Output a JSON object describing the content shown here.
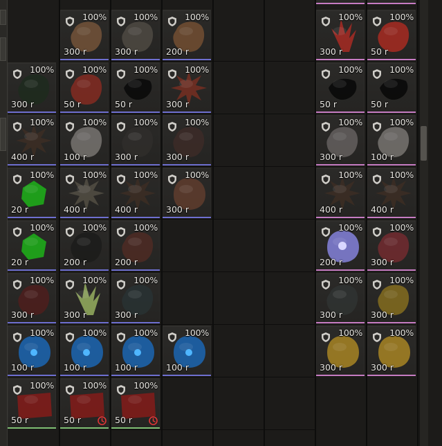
{
  "colors": {
    "underline_blue": "#6e6fd0",
    "underline_pink": "#c77cc3",
    "underline_green": "#7fbf74",
    "clock_red": "#e03636"
  },
  "left_items": [
    [
      null,
      {
        "pct": "100%",
        "price": "300 r",
        "icon": "coiled-tentacle-icon",
        "tint": "#6b4e37",
        "line": "blue"
      },
      {
        "pct": "100%",
        "price": "300 r",
        "icon": "bone-antler-icon",
        "tint": "#4a463f",
        "line": "blue"
      },
      {
        "pct": "100%",
        "price": "200 r",
        "icon": "organ-sac-icon",
        "tint": "#6a4a30",
        "line": "blue"
      }
    ],
    [
      {
        "pct": "100%",
        "price": "300 r",
        "icon": "dark-claw-icon",
        "tint": "#1f2a1f",
        "line": "blue"
      },
      {
        "pct": "100%",
        "price": "50 r",
        "icon": "red-crystal-icon",
        "tint": "#7a2a22",
        "line": "blue"
      },
      {
        "pct": "100%",
        "price": "50 r",
        "icon": "black-shard-icon",
        "tint": "#0c0c0c",
        "line": "blue"
      },
      {
        "pct": "100%",
        "price": "300 r",
        "icon": "red-spiked-pod-icon",
        "tint": "#6e2d22",
        "line": "blue"
      }
    ],
    [
      {
        "pct": "100%",
        "price": "400 r",
        "icon": "spiked-ball-icon",
        "tint": "#3a2c24",
        "line": "blue"
      },
      {
        "pct": "100%",
        "price": "100 r",
        "icon": "white-flower-icon",
        "tint": "#6f6c68",
        "line": "blue"
      },
      {
        "pct": "100%",
        "price": "300 r",
        "icon": "dark-rock-icon",
        "tint": "#2e2c2a",
        "line": "blue"
      },
      {
        "pct": "100%",
        "price": "300 r",
        "icon": "flesh-lump-icon",
        "tint": "#3a2a27",
        "line": "blue"
      }
    ],
    [
      {
        "pct": "100%",
        "price": "20 r",
        "icon": "green-gem-icon",
        "tint": "#1fa31a",
        "line": "blue"
      },
      {
        "pct": "100%",
        "price": "400 r",
        "icon": "pale-thistle-icon",
        "tint": "#4e4a40",
        "line": "blue"
      },
      {
        "pct": "100%",
        "price": "400 r",
        "icon": "spiked-ball-icon",
        "tint": "#3a2c24",
        "line": "blue"
      },
      {
        "pct": "100%",
        "price": "300 r",
        "icon": "brown-orb-icon",
        "tint": "#5a3a2c",
        "line": "blue"
      }
    ],
    [
      {
        "pct": "100%",
        "price": "20 r",
        "icon": "green-gem-icon",
        "tint": "#1fa31a",
        "line": "blue"
      },
      {
        "pct": "100%",
        "price": "200 r",
        "icon": "dark-vine-icon",
        "tint": "#1c1c1b",
        "line": "blue"
      },
      {
        "pct": "100%",
        "price": "200 r",
        "icon": "dried-fruit-icon",
        "tint": "#4a2a24",
        "line": "blue"
      },
      null
    ],
    [
      {
        "pct": "100%",
        "price": "300 r",
        "icon": "red-coral-icon",
        "tint": "#4a1f1e",
        "line": "blue"
      },
      {
        "pct": "100%",
        "price": "300 r",
        "icon": "green-sprout-icon",
        "tint": "#8aa05a",
        "line": "blue"
      },
      {
        "pct": "100%",
        "price": "300 r",
        "icon": "dark-crystal-icon",
        "tint": "#283032",
        "line": "blue"
      },
      null
    ],
    [
      {
        "pct": "100%",
        "price": "100 r",
        "icon": "blue-orb-icon",
        "tint": "#1c5fa3",
        "line": "blue"
      },
      {
        "pct": "100%",
        "price": "100 r",
        "icon": "blue-orb-icon",
        "tint": "#1c5fa3",
        "line": "blue"
      },
      {
        "pct": "100%",
        "price": "100 r",
        "icon": "blue-orb-icon",
        "tint": "#1c5fa3",
        "line": "blue"
      },
      {
        "pct": "100%",
        "price": "100 r",
        "icon": "blue-orb-icon",
        "tint": "#1c5fa3",
        "line": "blue"
      }
    ],
    [
      {
        "pct": "100%",
        "price": "50 r",
        "icon": "red-meat-icon",
        "tint": "#7a1c1a",
        "line": "green",
        "clock": false
      },
      {
        "pct": "100%",
        "price": "50 r",
        "icon": "red-meat-icon",
        "tint": "#7a1c1a",
        "line": "green",
        "clock": true
      },
      {
        "pct": "100%",
        "price": "50 r",
        "icon": "red-meat-icon",
        "tint": "#7a1c1a",
        "line": "green",
        "clock": true
      },
      null
    ]
  ],
  "right_items": [
    [
      {
        "pct": "100%",
        "price": "300 r",
        "icon": "red-crystal-cluster-icon",
        "tint": "#9a2a24",
        "line": "pink"
      },
      {
        "pct": "100%",
        "price": "50 r",
        "icon": "red-root-icon",
        "tint": "#9a2a22",
        "line": "pink"
      }
    ],
    [
      {
        "pct": "100%",
        "price": "50 r",
        "icon": "black-shard-icon",
        "tint": "#0b0b0b",
        "line": "pink"
      },
      {
        "pct": "100%",
        "price": "50 r",
        "icon": "black-shard-icon",
        "tint": "#0b0b0b",
        "line": "pink"
      }
    ],
    [
      {
        "pct": "100%",
        "price": "300 r",
        "icon": "pale-flower-icon",
        "tint": "#5e5a58",
        "line": "pink"
      },
      {
        "pct": "100%",
        "price": "100 r",
        "icon": "white-flower-icon",
        "tint": "#6f6c68",
        "line": "pink"
      }
    ],
    [
      {
        "pct": "100%",
        "price": "400 r",
        "icon": "spiked-ball-icon",
        "tint": "#3a2c24",
        "line": "pink"
      },
      {
        "pct": "100%",
        "price": "400 r",
        "icon": "spiked-ball-icon",
        "tint": "#3a2c24",
        "line": "pink"
      }
    ],
    [
      {
        "pct": "100%",
        "price": "200 r",
        "icon": "glowing-star-icon",
        "tint": "#7a78c8",
        "line": "pink"
      },
      {
        "pct": "100%",
        "price": "300 r",
        "icon": "red-tentacle-icon",
        "tint": "#6a2a2e",
        "line": "pink"
      }
    ],
    [
      {
        "pct": "100%",
        "price": "300 r",
        "icon": "dark-stone-icon",
        "tint": "#2e3130",
        "line": "pink"
      },
      {
        "pct": "100%",
        "price": "300 r",
        "icon": "gold-veined-rock-icon",
        "tint": "#7a6520",
        "line": "pink"
      }
    ],
    [
      {
        "pct": "100%",
        "price": "300 r",
        "icon": "golden-web-orb-icon",
        "tint": "#9a7a24",
        "line": "pink"
      },
      {
        "pct": "100%",
        "price": "300 r",
        "icon": "golden-web-orb-icon",
        "tint": "#9a7a24",
        "line": "pink"
      }
    ]
  ]
}
